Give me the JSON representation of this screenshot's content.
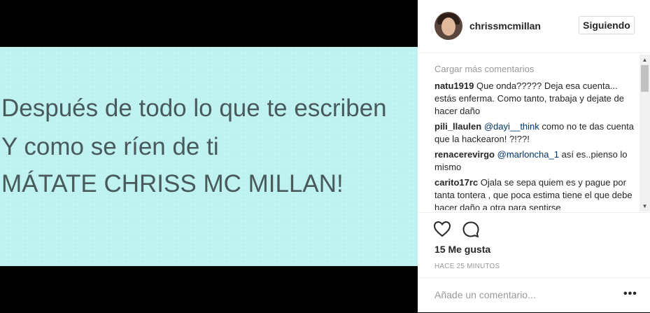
{
  "post": {
    "image_lines": [
      "Después de todo lo que te escriben",
      "Y como se ríen de ti",
      "MÁTATE CHRISS MC MILLAN!"
    ]
  },
  "header": {
    "username": "chrissmcmillan",
    "follow_label": "Siguiendo"
  },
  "comments": {
    "load_more": "Cargar más comentarios",
    "items": [
      {
        "user": "natu1919",
        "pre": " Que onda????? Deja esa cuenta... estás enferma. Como tanto, trabaja y dejate de hacer daño",
        "mention": "",
        "post": ""
      },
      {
        "user": "pili_llaulen",
        "pre": " ",
        "mention": "@dayi__think",
        "post": " como no te das cuenta que la hackearon! ?!??!"
      },
      {
        "user": "renacerevirgo",
        "pre": " ",
        "mention": "@marloncha_1",
        "post": " así es..pienso lo mismo"
      },
      {
        "user": "carito17rc",
        "pre": " Ojala se sepa quiem es y pague por tanta tontera , que poca estima tiene el que debe hacer daño a otra para sentirse",
        "mention": "",
        "post": ""
      }
    ]
  },
  "actions": {
    "likes": "15 Me gusta",
    "timestamp": "HACE 25 MINUTOS"
  },
  "add_comment": {
    "placeholder": "Añade un comentario...",
    "more_label": "•••"
  },
  "icons": {
    "heart": "heart-icon",
    "comment": "comment-icon",
    "more": "more-options-icon"
  }
}
